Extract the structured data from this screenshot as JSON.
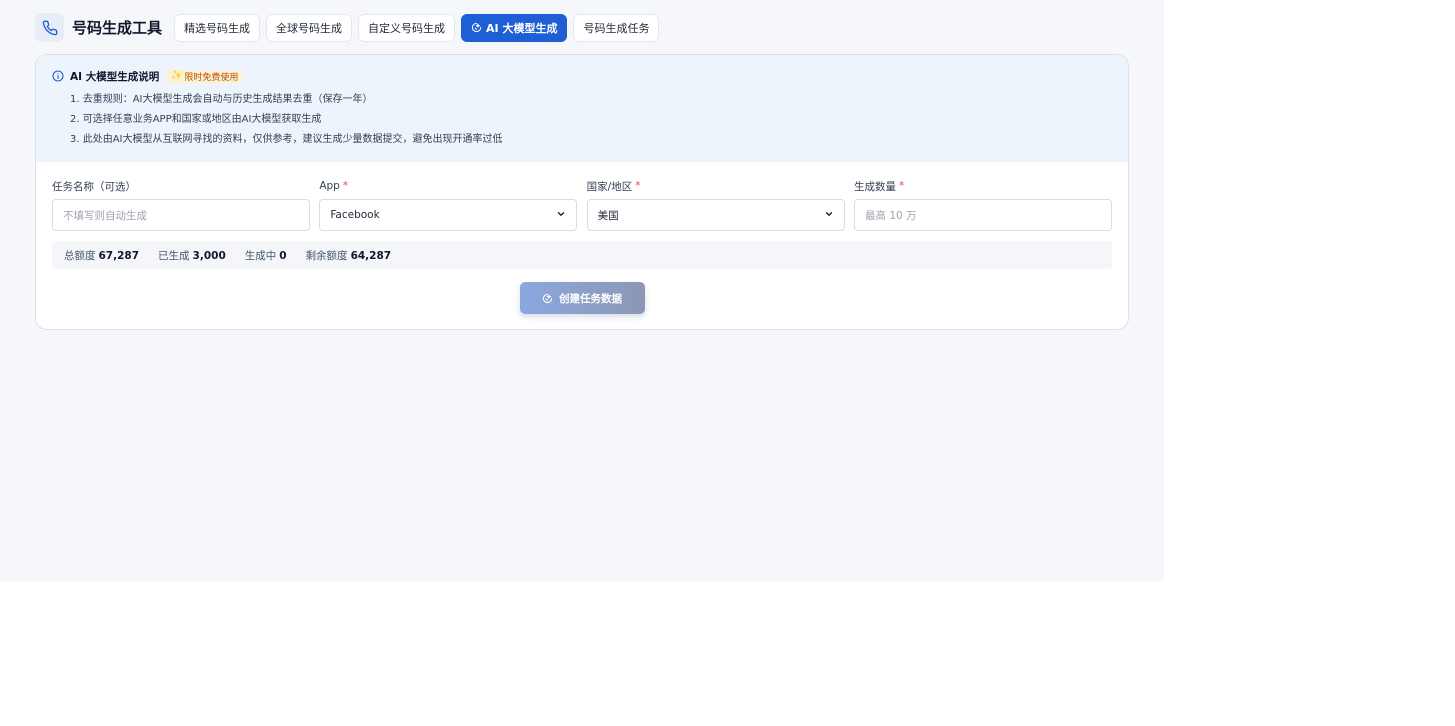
{
  "header": {
    "title": "号码生成工具",
    "icon": "phone-icon",
    "tabs": [
      {
        "label": "精选号码生成",
        "active": false
      },
      {
        "label": "全球号码生成",
        "active": false
      },
      {
        "label": "自定义号码生成",
        "active": false
      },
      {
        "label": "AI 大模型生成",
        "active": true,
        "icon": "ai-spark-icon"
      },
      {
        "label": "号码生成任务",
        "active": false
      }
    ]
  },
  "notice": {
    "title": "AI 大模型生成说明",
    "badge": "限时免费使用",
    "rules": [
      "1. 去重规则：AI大模型生成会自动与历史生成结果去重（保存一年）",
      "2. 可选择任意业务APP和国家或地区由AI大模型获取生成",
      "3. 此处由AI大模型从互联网寻找的资料，仅供参考，建议生成少量数据提交，避免出现开通率过低"
    ]
  },
  "form": {
    "task_name": {
      "label": "任务名称（可选）",
      "placeholder": "不填写则自动生成"
    },
    "app": {
      "label": "App",
      "required": "*",
      "value": "Facebook"
    },
    "country": {
      "label": "国家/地区",
      "required": "*",
      "value": "美国"
    },
    "quantity": {
      "label": "生成数量",
      "required": "*",
      "placeholder": "最高 10 万"
    }
  },
  "quota": {
    "total_label": "总额度",
    "total_value": "67,287",
    "generated_label": "已生成",
    "generated_value": "3,000",
    "generating_label": "生成中",
    "generating_value": "0",
    "remaining_label": "剩余额度",
    "remaining_value": "64,287"
  },
  "actions": {
    "create_label": "创建任务数据"
  },
  "colors": {
    "accent": "#1e5fd6",
    "required": "#ef4444",
    "badge_bg": "#fdf1d3",
    "badge_text": "#b45309"
  }
}
